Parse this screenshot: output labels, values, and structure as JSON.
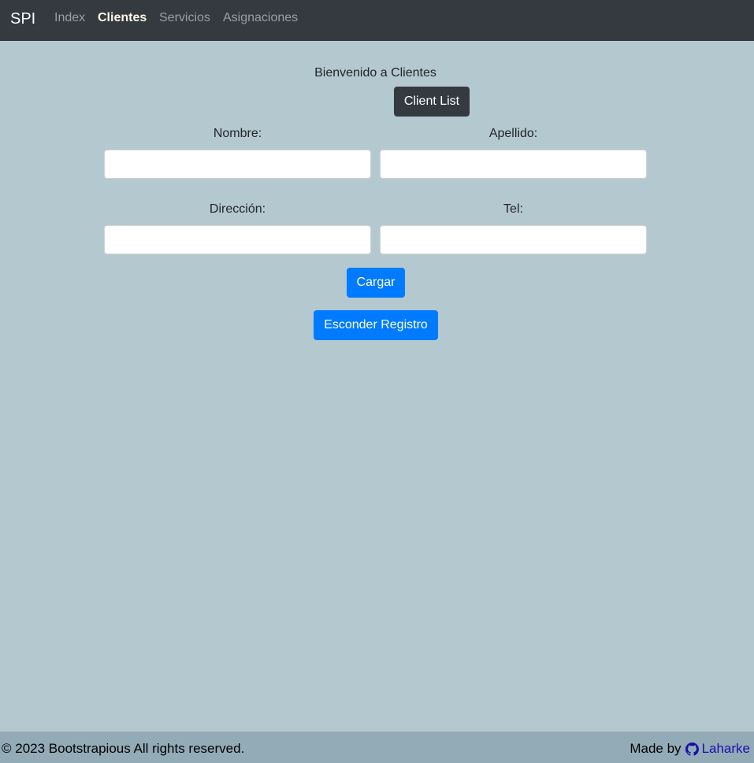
{
  "navbar": {
    "brand": "SPI",
    "links": [
      {
        "label": "Index",
        "active": false
      },
      {
        "label": "Clientes",
        "active": true
      },
      {
        "label": "Servicios",
        "active": false
      },
      {
        "label": "Asignaciones",
        "active": false
      }
    ]
  },
  "main": {
    "welcome": "Bienvenido a Clientes",
    "client_list_button": "Client List",
    "form": {
      "nombre_label": "Nombre:",
      "nombre_value": "",
      "apellido_label": "Apellido:",
      "apellido_value": "",
      "direccion_label": "Dirección:",
      "direccion_value": "",
      "tel_label": "Tel:",
      "tel_value": "",
      "submit_button": "Cargar"
    },
    "toggle_button": "Esconder Registro"
  },
  "footer": {
    "copyright": "© 2023 Bootstrapious All rights reserved.",
    "made_by": "Made by",
    "author_link": "Laharke",
    "author_icon": "github-icon"
  },
  "colors": {
    "background": "#b4c8cf",
    "navbar": "#343a40",
    "primary": "#007bff",
    "footer": "#93abb6",
    "link": "#1a0dab"
  }
}
